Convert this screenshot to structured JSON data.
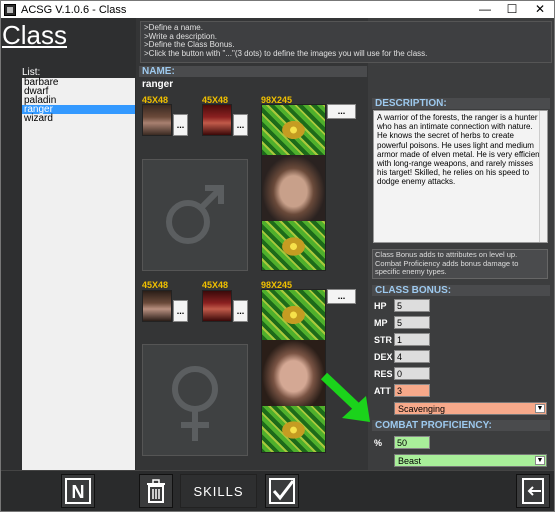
{
  "window": {
    "title": "ACSG V.1.0.6 - Class",
    "min": "—",
    "max": "☐",
    "close": "✕"
  },
  "page_title": "Class",
  "list": {
    "label": "List:",
    "items": [
      "barbare",
      "dwarf",
      "paladin",
      "ranger",
      "wizard"
    ],
    "selected": "ranger"
  },
  "instructions": [
    ">Define a name.",
    ">Write a description.",
    ">Define the Class Bonus.",
    ">Click the button with \"...\"(3 dots) to define the images you will use for the class."
  ],
  "name": {
    "label": "NAME:",
    "value": "ranger"
  },
  "images": {
    "small_label": "45X48",
    "tall_label": "98X245",
    "dots": "...",
    "male_symbol": "♂",
    "female_symbol": "♀"
  },
  "description": {
    "label": "DESCRIPTION:",
    "text": "A warrior of the forests, the ranger is a hunter who has an intimate connection with nature. He knows the secret of herbs to create powerful poisons. He uses light and medium armor made of elven metal. He is very efficient with long-range weapons, and rarely misses his target! Skilled, he relies on his speed to dodge enemy attacks."
  },
  "bonus_note": "Class Bonus adds to attributes on level up. Combat Proficiency adds bonus damage to specific enemy types.",
  "class_bonus": {
    "label": "CLASS BONUS:",
    "stats": [
      {
        "name": "HP",
        "value": "5"
      },
      {
        "name": "MP",
        "value": "5"
      },
      {
        "name": "STR",
        "value": "1"
      },
      {
        "name": "DEX",
        "value": "4"
      },
      {
        "name": "RES",
        "value": "0"
      },
      {
        "name": "ATT",
        "value": "3"
      }
    ],
    "skill_select": "Scavenging"
  },
  "combat": {
    "label": "COMBAT PROFICIENCY:",
    "pct_label": "%",
    "pct_value": "50",
    "enemy_select": "Beast"
  },
  "bottom": {
    "new_icon": "N",
    "skills_label": "SKILLS"
  },
  "colors": {
    "accent_label": "#9dc9ee",
    "dim_label": "#f0c000",
    "highlight_att": "#f7a98a",
    "highlight_combat": "#a9ef9a",
    "arrow": "#1bd31b",
    "list_selected": "#3399ff"
  },
  "icons": [
    "app-icon",
    "male-symbol-icon",
    "female-symbol-icon",
    "new-icon",
    "trash-icon",
    "checkmark-icon",
    "exit-icon",
    "dropdown-arrow-icon",
    "green-arrow-icon"
  ]
}
